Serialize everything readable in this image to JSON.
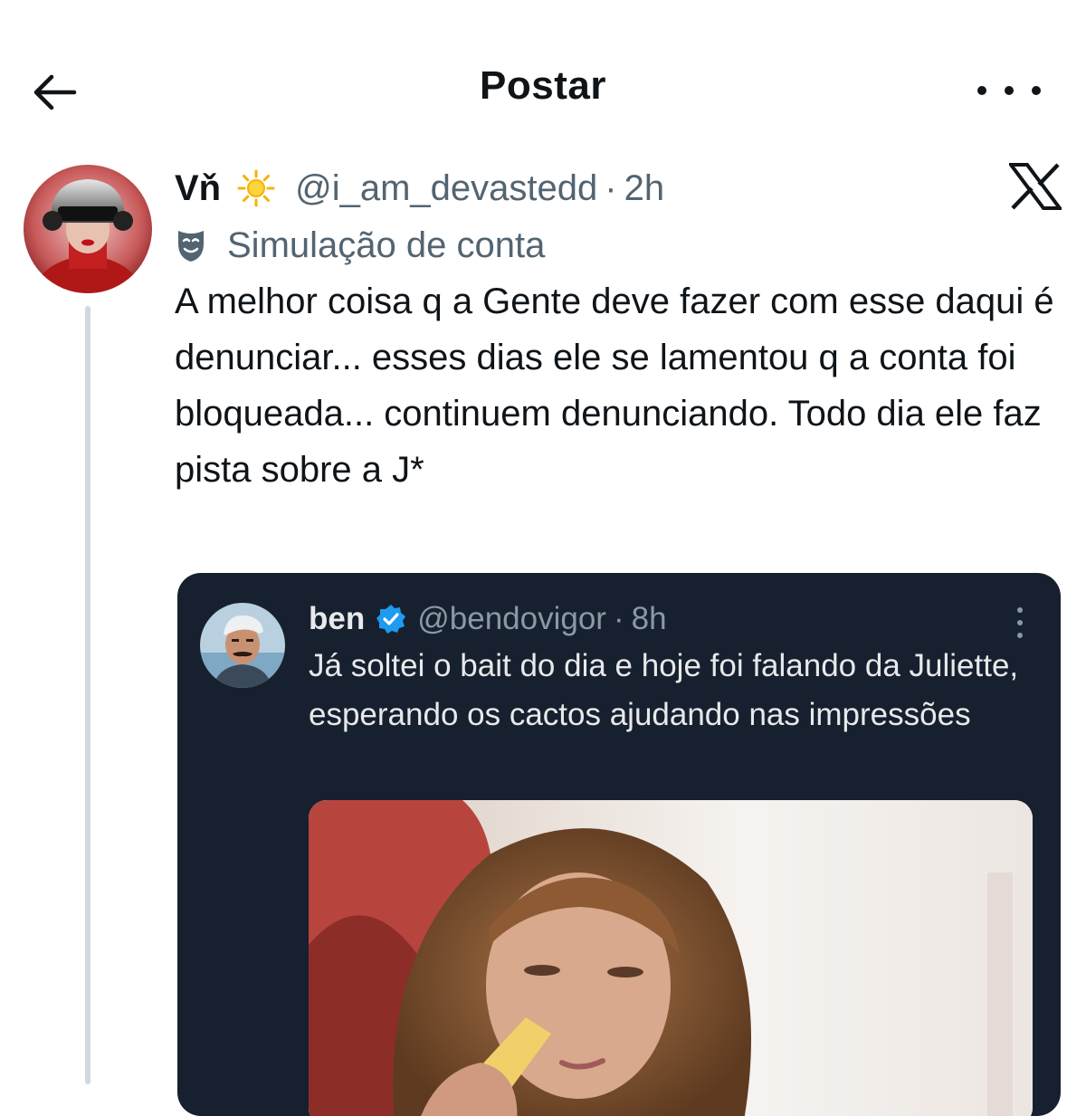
{
  "header": {
    "title": "Postar",
    "back_icon": "arrow-left-icon",
    "more_icon": "more-horizontal-icon"
  },
  "post": {
    "author_name": "Vň",
    "emoji_icon": "sun-icon",
    "handle": "@i_am_devastedd",
    "separator": "·",
    "time": "2h",
    "account_label": "Simulação de conta",
    "text": "A melhor coisa q a Gente deve fazer com esse daqui é denunciar... esses dias ele se lamentou q a conta foi bloqueada... continuem denunciando. Todo dia ele faz pista sobre a J*"
  },
  "quoted_post": {
    "author_name": "ben",
    "verified_icon": "verified-badge-icon",
    "handle": "@bendovigor",
    "separator": "·",
    "time": "8h",
    "text": "Já soltei o bait do dia e hoje foi falando da Juliette, esperando os cactos ajudando nas impressões"
  },
  "colors": {
    "text_primary": "#0f1419",
    "text_secondary": "#536471",
    "thread_line": "#cfd9de",
    "quote_bg": "#17202e",
    "quote_text": "#e7e9ea",
    "quote_secondary": "#8b98a5",
    "verified_blue": "#1d9bf0"
  }
}
